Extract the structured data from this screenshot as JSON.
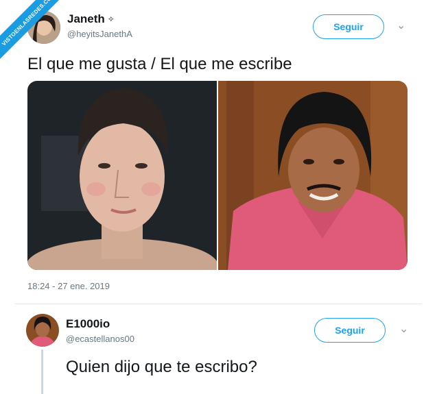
{
  "watermark": "VISTOENLASREDES.COM",
  "tweet": {
    "author_name": "Janeth",
    "badge": "✧",
    "handle": "@heyitsJanethA",
    "follow_label": "Seguir",
    "text": "El que me gusta / El que me escribe",
    "timestamp": "18:24 - 27 ene. 2019"
  },
  "reply": {
    "author_name": "E1000io",
    "handle": "@ecastellanos00",
    "follow_label": "Seguir",
    "text": "Quien dijo que te escribo?"
  },
  "colors": {
    "accent": "#1da1f2",
    "ribbon": "#1b9be0",
    "shirt": "#e05a7a",
    "wood": "#8b4e24"
  }
}
